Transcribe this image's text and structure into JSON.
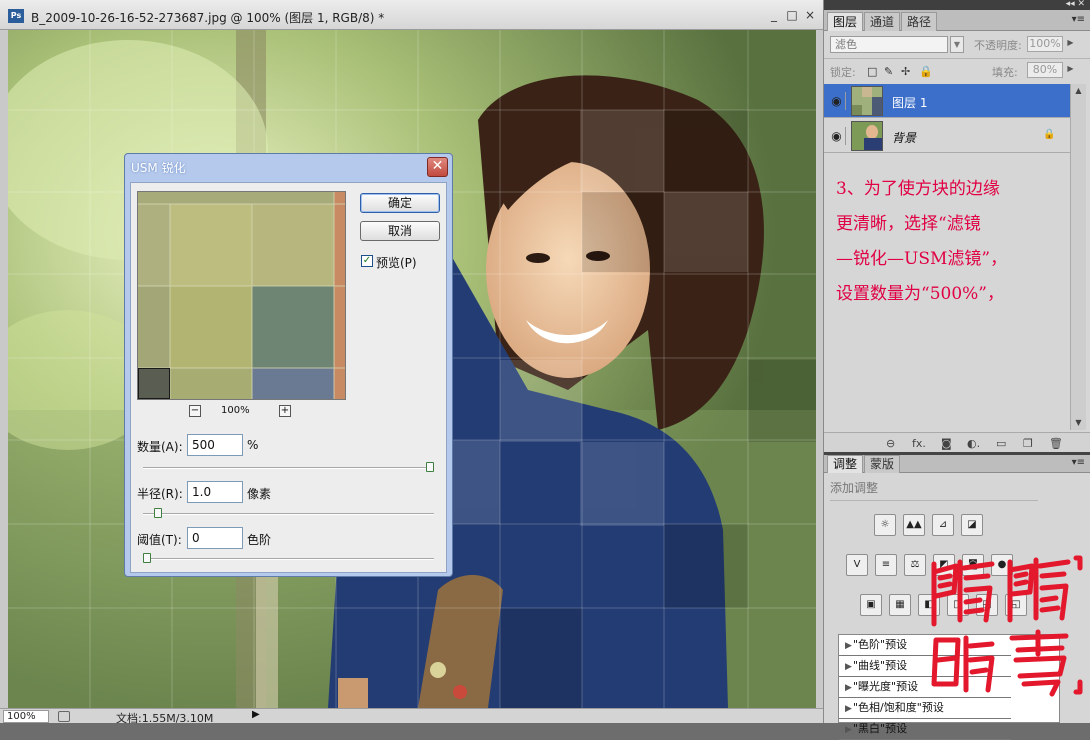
{
  "document": {
    "app_icon": "Ps",
    "title": "B_2009-10-26-16-52-273687.jpg @ 100% (图层 1, RGB/8) *",
    "window_controls": [
      "_",
      "□",
      "×"
    ],
    "status": {
      "zoom": "100%",
      "info": "文档:1.55M/3.10M",
      "arrow": "▶"
    }
  },
  "dialog": {
    "title": "USM 锐化",
    "close_glyph": "✕",
    "ok_label": "确定",
    "cancel_label": "取消",
    "preview_checked": true,
    "preview_label": "预览(P)",
    "zoom_out": "−",
    "zoom_in": "+",
    "zoom_level": "100%",
    "fields": [
      {
        "label": "数量(A):",
        "value": "500",
        "unit": "%",
        "slider_fraction": 1.0
      },
      {
        "label": "半径(R):",
        "value": "1.0",
        "unit": "像素",
        "slider_fraction": 0.04
      },
      {
        "label": "阈值(T):",
        "value": "0",
        "unit": "色阶",
        "slider_fraction": 0.0
      }
    ]
  },
  "layers_panel": {
    "tabs": [
      "图层",
      "通道",
      "路径"
    ],
    "active_tab": 0,
    "blend_mode": "滤色",
    "opacity_label": "不透明度:",
    "opacity_value": "100%",
    "lock_label": "锁定:",
    "fill_label": "填充:",
    "fill_value": "80%",
    "lock_icons": [
      "□",
      "✎",
      "✢",
      "🔒"
    ],
    "layers": [
      {
        "name": "图层 1",
        "selected": true,
        "locked": false
      },
      {
        "name": "背景",
        "selected": false,
        "locked": true
      }
    ],
    "annotation": [
      "3、为了使方块的边缘",
      "更清晰，选择“滤镜",
      "—锐化—USM滤镜”，",
      "设置数量为“500%”，"
    ],
    "footer_icons": [
      "link-icon",
      "fx-icon",
      "mask-icon",
      "adjustment-icon",
      "group-icon",
      "new-layer-icon",
      "trash-icon"
    ],
    "footer_glyphs": [
      "⊖",
      "fx.",
      "◙",
      "◐.",
      "▭",
      "❐",
      "🗑"
    ]
  },
  "adjustments_panel": {
    "tabs": [
      "调整",
      "蒙版"
    ],
    "active_tab": 0,
    "add_label": "添加调整",
    "row1": [
      "☼",
      "▲▲",
      "⊿",
      "◪"
    ],
    "row2": [
      "V",
      "≡",
      "⚖",
      "◩",
      "◙",
      "●"
    ],
    "row3": [
      "▣",
      "▦",
      "◧",
      "◨",
      "◰",
      "◱"
    ],
    "presets": [
      "\"色阶\"预设",
      "\"曲线\"预设",
      "\"曝光度\"预设",
      "\"色相/饱和度\"预设",
      "\"黑白\"预设"
    ]
  },
  "colors": {
    "selection": "#3c6fca",
    "annotation": "#e00043",
    "seal": "#e3182d"
  }
}
